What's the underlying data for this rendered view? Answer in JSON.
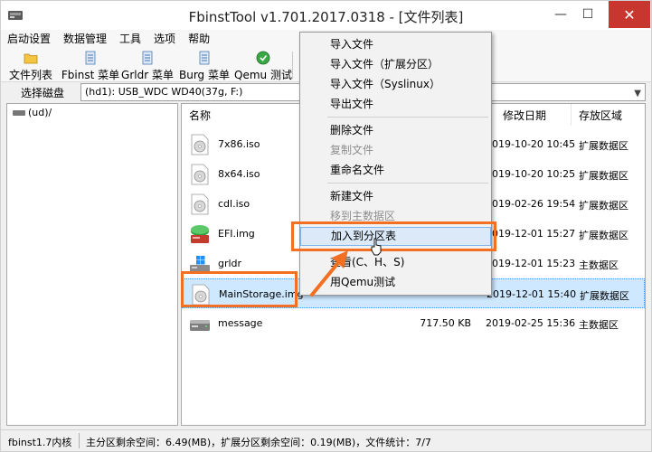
{
  "window": {
    "title": "FbinstTool v1.701.2017.0318 - [文件列表]",
    "minimize": "—",
    "maximize": "☐",
    "close": "✕"
  },
  "menubar": [
    "启动设置",
    "数据管理",
    "工具",
    "选项",
    "帮助"
  ],
  "toolbar": {
    "file_list": "文件列表",
    "fbinst_menu": "Fbinst 菜单",
    "grldr_menu": "Grldr 菜单",
    "burg_menu": "Burg 菜单",
    "qemu_test": "Qemu 测试"
  },
  "disk": {
    "label": "选择磁盘",
    "value": "(hd1): USB_WDC WD40(37g, F:)"
  },
  "tree": {
    "root": "(ud)/"
  },
  "list": {
    "columns": {
      "name": "名称",
      "modified": "修改日期",
      "zone": "存放区域"
    },
    "rows": [
      {
        "name": "7x86.iso",
        "size": "",
        "date": "2019-10-20 10:45",
        "zone": "扩展数据区",
        "icon": "disc-icon"
      },
      {
        "name": "8x64.iso",
        "size": "",
        "date": "2019-10-20 10:25",
        "zone": "扩展数据区",
        "icon": "disc-icon"
      },
      {
        "name": "cdl.iso",
        "size": "",
        "date": "2019-02-26 19:54",
        "zone": "扩展数据区",
        "icon": "disc-icon"
      },
      {
        "name": "EFI.img",
        "size": "",
        "date": "2019-12-01 15:27",
        "zone": "扩展数据区",
        "icon": "disk-image-icon"
      },
      {
        "name": "grldr",
        "size": "",
        "date": "2019-12-01 15:23",
        "zone": "主数据区",
        "icon": "system-file-icon"
      },
      {
        "name": "MainStorage.img",
        "size": "",
        "date": "2019-12-01 15:40",
        "zone": "扩展数据区",
        "icon": "disc-icon"
      },
      {
        "name": "message",
        "size": "717.50 KB",
        "date": "2019-02-25 15:36",
        "zone": "主数据区",
        "icon": "drive-icon"
      }
    ]
  },
  "context_menu": {
    "items": [
      {
        "label": "导入文件",
        "disabled": false
      },
      {
        "label": "导入文件（扩展分区）",
        "disabled": false
      },
      {
        "label": "导入文件（Syslinux）",
        "disabled": false
      },
      {
        "label": "导出文件",
        "disabled": false
      },
      {
        "label": "删除文件",
        "disabled": false
      },
      {
        "label": "复制文件",
        "disabled": true
      },
      {
        "label": "重命名文件",
        "disabled": false
      },
      {
        "label": "新建文件",
        "disabled": false
      },
      {
        "label": "移到主数据区",
        "disabled": true
      },
      {
        "label": "加入到分区表",
        "disabled": false
      },
      {
        "label": "查看(C、H、S)",
        "disabled": false
      },
      {
        "label": "用Qemu测试",
        "disabled": false
      }
    ]
  },
  "status": {
    "left": "fbinst1.7内核",
    "right": "主分区剩余空间：6.49(MB)，扩展分区剩余空间：0.19(MB)，文件统计：7/7"
  },
  "colors": {
    "highlight": "#f36f21",
    "selection": "#cde8ff",
    "menu_hover": "#dbe9f9",
    "close_button": "#c7372f"
  }
}
